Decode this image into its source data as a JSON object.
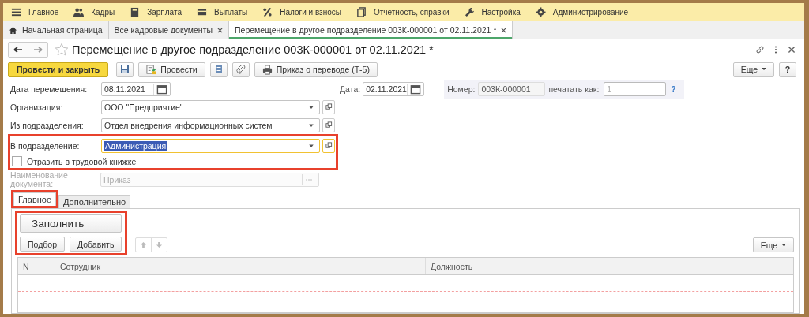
{
  "menu": [
    {
      "label": "Главное",
      "kind": "menu"
    },
    {
      "label": "Кадры",
      "kind": "people"
    },
    {
      "label": "Зарплата",
      "kind": "calculator"
    },
    {
      "label": "Выплаты",
      "kind": "card"
    },
    {
      "label": "Налоги и взносы",
      "kind": "percent"
    },
    {
      "label": "Отчетность, справки",
      "kind": "documents"
    },
    {
      "label": "Настройка",
      "kind": "wrench"
    },
    {
      "label": "Администрирование",
      "kind": "gear"
    }
  ],
  "open_tabs": [
    {
      "label": "Начальная страница",
      "kind": "home",
      "selected": false,
      "closable": false
    },
    {
      "label": "Все кадровые документы",
      "kind": "document",
      "selected": false,
      "closable": true
    },
    {
      "label": "Перемещение в другое подразделение 003К-000001 от 02.11.2021 *",
      "kind": "document",
      "selected": true,
      "closable": true
    }
  ],
  "form": {
    "title": "Перемещение в другое подразделение 003К-000001 от 02.11.2021 *",
    "toolbar": [
      {
        "label": "Провести и закрыть",
        "kind": "primary"
      },
      {
        "kind": "save"
      },
      {
        "label": "Провести",
        "kind": "post"
      },
      {
        "kind": "list"
      },
      {
        "kind": "clip"
      },
      {
        "label": "Приказ о переводе (Т-5)",
        "kind": "print"
      }
    ],
    "more_button": "Еще",
    "help_button": "?"
  },
  "header": {
    "date_label": "Дата:",
    "date": "02.11.2021",
    "number_label": "Номер:",
    "number": "003К-000001",
    "print_label": "печатать как:",
    "print_as": "1",
    "help": "?"
  },
  "fields": [
    {
      "label": "Дата перемещения:",
      "value": "08.11.2021",
      "kind": "date",
      "focused": false,
      "highlighted": false
    },
    {
      "label": "Организация:",
      "value": "ООО \"Предприятие\"",
      "kind": "select",
      "focused": false,
      "highlighted": false
    },
    {
      "label": "Из подразделения:",
      "value": "Отдел внедрения информационных систем",
      "kind": "select",
      "focused": false,
      "highlighted": false
    },
    {
      "label": "В подразделение:",
      "value": "Администрация",
      "kind": "select",
      "focused": true,
      "highlighted": true
    },
    {
      "label": "Отразить в трудовой книжке",
      "kind": "checkbox",
      "checked": false,
      "highlighted": true
    },
    {
      "label": "Наименование документа:",
      "value": "Приказ",
      "kind": "text",
      "disabled": true,
      "highlighted": false
    }
  ],
  "tabs": [
    {
      "label": "Главное",
      "selected": true,
      "highlighted": true
    },
    {
      "label": "Дополнительно",
      "selected": false,
      "highlighted": false
    }
  ],
  "table_toolbar": {
    "fill_button": "Заполнить",
    "buttons": [
      "Подбор",
      "Добавить"
    ],
    "highlighted": true,
    "more_button": "Еще"
  },
  "table": {
    "columns": [
      "N",
      "Сотрудник",
      "Должность"
    ]
  }
}
